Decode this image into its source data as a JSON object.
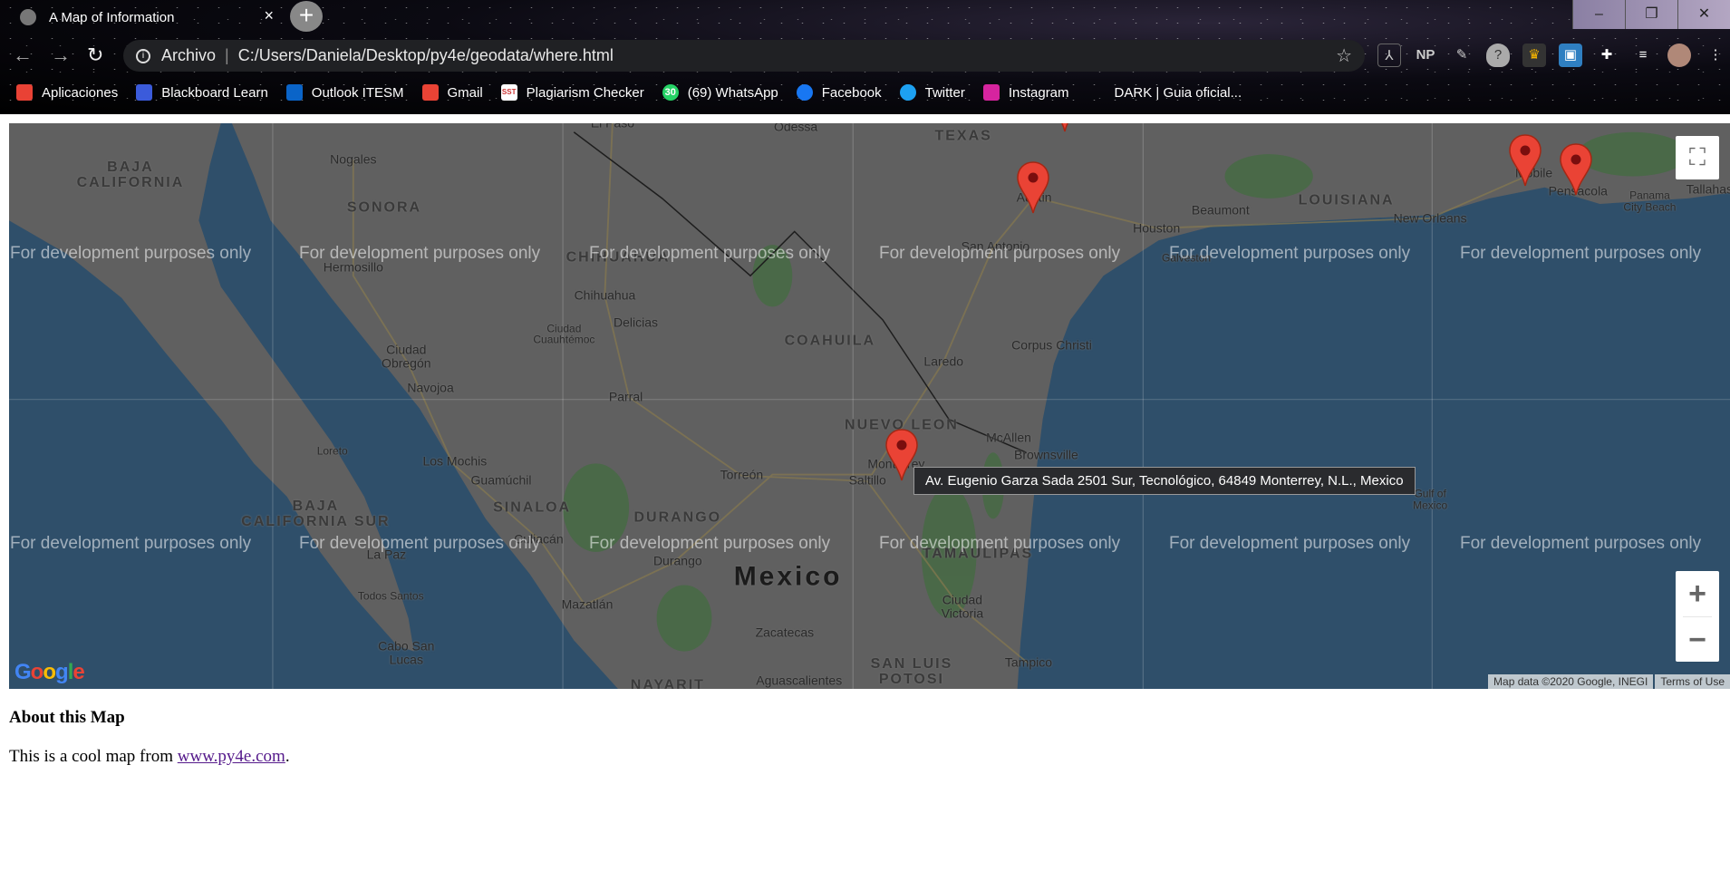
{
  "browser": {
    "tab_title": "A Map of Information",
    "close_label": "×",
    "new_tab_label": "+",
    "window_buttons": [
      "–",
      "❐",
      "✕"
    ],
    "omnibox": {
      "security_label": "Archivo",
      "url": "C:/Users/Daniela/Desktop/py4e/geodata/where.html"
    },
    "extensions": [
      "pdf-icon",
      "NP",
      "pen-icon",
      "shield-icon",
      "crown-icon",
      "save-icon",
      "puzzle-icon",
      "playlist-icon",
      "avatar",
      "menu-icon"
    ],
    "ext_np_label": "NP",
    "bookmarks": [
      {
        "label": "Aplicaciones",
        "icon": "apps-icon",
        "color": "#e94235"
      },
      {
        "label": "Blackboard Learn",
        "icon": "blackboard-icon",
        "color": "#3b5bdb"
      },
      {
        "label": "Outlook ITESM",
        "icon": "outlook-icon",
        "color": "#0a64c8"
      },
      {
        "label": "Gmail",
        "icon": "gmail-icon",
        "color": "#ea4335"
      },
      {
        "label": "Plagiarism Checker",
        "icon": "sst-icon",
        "color": "#ffffff"
      },
      {
        "label": "(69) WhatsApp",
        "icon": "whatsapp-icon",
        "color": "#25d366"
      },
      {
        "label": "Facebook",
        "icon": "facebook-icon",
        "color": "#1877f2"
      },
      {
        "label": "Twitter",
        "icon": "twitter-icon",
        "color": "#1da1f2"
      },
      {
        "label": "Instagram",
        "icon": "instagram-icon",
        "color": "#d6249f"
      },
      {
        "label": "DARK | Guia oficial...",
        "icon": "",
        "color": ""
      }
    ],
    "whatsapp_badge": "30",
    "sst_badge": "SST"
  },
  "map": {
    "watermark": "For development purposes only",
    "labels": [
      "BAJA\nCALIFORNIA",
      "SONORA",
      "Hermosillo",
      "CHIHUAHUA",
      "Chihuahua",
      "Delicias",
      "Ciudad\nCuauhtémoc",
      "COAHUILA",
      "Ciudad\nObregón",
      "Navojoa",
      "Parral",
      "Laredo",
      "Corpus Christi",
      "San Antonio",
      "Houston",
      "Beaumont",
      "LOUISIANA",
      "New Orleans",
      "Austin",
      "TEXAS",
      "Odessa",
      "El Paso",
      "Nogales",
      "Mobile",
      "Pensacola",
      "Panama\nCity Beach",
      "Tallahass",
      "NUEVO LEON",
      "McAllen",
      "Brownsville",
      "Monterrey",
      "Saltillo",
      "Torreón",
      "Los Mochis",
      "Guamúchil",
      "BAJA\nCALIFORNIA SUR",
      "SINALOA",
      "DURANGO",
      "Culiacán",
      "Durango",
      "La Paz",
      "Mexico",
      "TAMAULIPAS",
      "Ciudad\nVictoria",
      "Todos Santos",
      "Mazatlán",
      "Zacatecas",
      "Cabo San\nLucas",
      "SAN LUIS\nPOTOSI",
      "Tampico",
      "Aguascalientes",
      "NAYARIT",
      "Gulf of\nMexico",
      "Loreto",
      "Galveston"
    ],
    "marker_color": "#ea4335",
    "tooltip": "Av. Eugenio Garza Sada 2501 Sur, Tecnológico, 64849 Monterrey, N.L., Mexico",
    "fullscreen_icon": "fullscreen-icon",
    "zoom_in": "+",
    "zoom_out": "−",
    "logo": "Google",
    "attribution": "Map data ©2020 Google, INEGI",
    "terms": "Terms of Use",
    "land_color": "#6e6e6e",
    "water_color": "#365a79"
  },
  "content": {
    "heading": "About this Map",
    "text_before": "This is a cool map from ",
    "link": "www.py4e.com",
    "text_after": "."
  }
}
